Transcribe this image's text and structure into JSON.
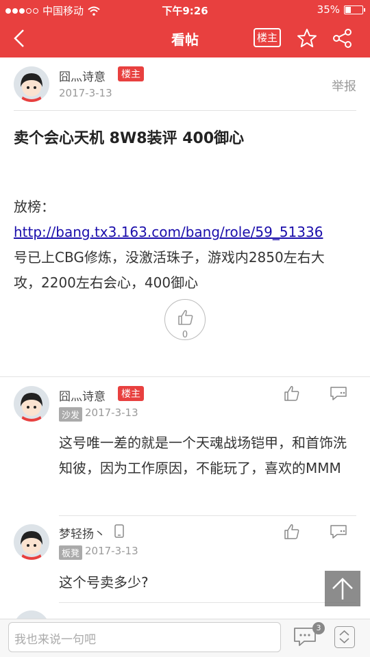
{
  "status": {
    "carrier": "中国移动",
    "time": "下午9:26",
    "battery": "35%",
    "battery_level": 0.35
  },
  "nav": {
    "title": "看帖",
    "owner_label": "楼主"
  },
  "post": {
    "author": "囧灬诗意",
    "badge": "楼主",
    "date": "2017-3-13",
    "report": "举报",
    "title": "卖个会心天机 8W8装评 400御心",
    "body_prefix": "放榜：",
    "link": "http://bang.tx3.163.com/bang/role/59_51336",
    "body_rest": "号已上CBG修炼，没激活珠子，游戏内2850左右大攻，2200左右会心，400御心",
    "likes": "0"
  },
  "replies": [
    {
      "author": "囧灬诗意",
      "badge": "楼主",
      "floor": "沙发",
      "date": "2017-3-13",
      "text": "这号唯一差的就是一个天魂战场铠甲，和首饰洗知彼，因为工作原因，不能玩了，喜欢的MMM"
    },
    {
      "author": "梦轻扬丶",
      "floor": "板凳",
      "date": "2017-3-13",
      "text": "这个号卖多少?"
    }
  ],
  "bottom": {
    "placeholder": "我也来说一句吧",
    "comment_count": "3"
  },
  "colors": {
    "accent": "#e8403f"
  }
}
